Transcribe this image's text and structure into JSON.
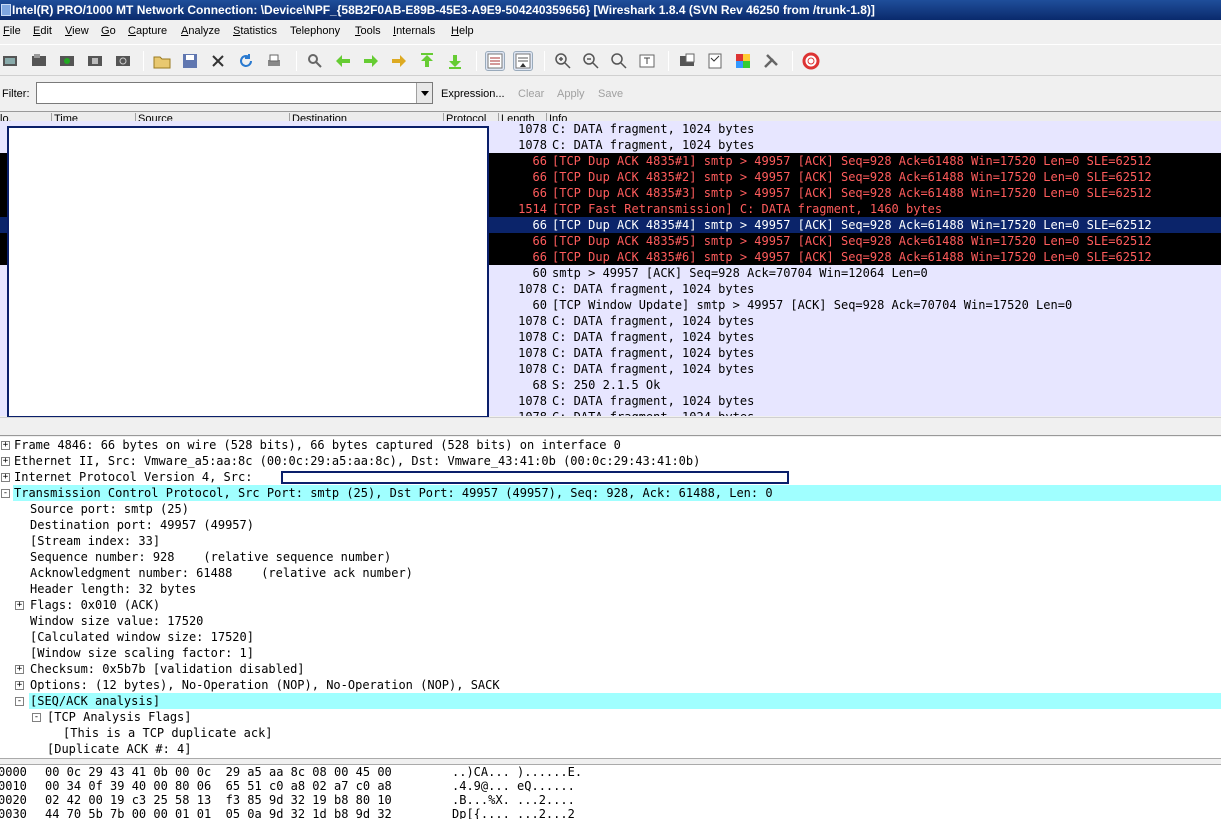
{
  "window": {
    "title": "Intel(R) PRO/1000 MT Network Connection: \\Device\\NPF_{58B2F0AB-E89B-45E3-A9E9-504240359656}  [Wireshark 1.8.4  (SVN Rev 46250 from /trunk-1.8)]"
  },
  "menu": [
    {
      "label": "File",
      "u": "F",
      "rest": "ile"
    },
    {
      "label": "Edit",
      "u": "E",
      "rest": "dit"
    },
    {
      "label": "View",
      "u": "V",
      "rest": "iew"
    },
    {
      "label": "Go",
      "u": "G",
      "rest": "o"
    },
    {
      "label": "Capture",
      "u": "C",
      "rest": "apture"
    },
    {
      "label": "Analyze",
      "u": "A",
      "rest": "nalyze"
    },
    {
      "label": "Statistics",
      "u": "S",
      "rest": "tatistics"
    },
    {
      "label": "Telephony",
      "u": "",
      "rest": "Telephony"
    },
    {
      "label": "Tools",
      "u": "T",
      "rest": "ools"
    },
    {
      "label": "Internals",
      "u": "I",
      "rest": "nternals"
    },
    {
      "label": "Help",
      "u": "H",
      "rest": "elp"
    }
  ],
  "toolbar": {
    "icons": [
      "interface-list-icon",
      "capture-options-icon",
      "start-capture-icon",
      "stop-capture-icon",
      "restart-capture-icon",
      "open-file-icon",
      "save-file-icon",
      "close-file-icon",
      "reload-icon",
      "print-icon",
      "find-icon",
      "go-back-icon",
      "go-forward-icon",
      "go-to-packet-icon",
      "first-packet-icon",
      "last-packet-icon",
      "colorize-icon",
      "auto-scroll-icon",
      "zoom-in-icon",
      "zoom-out-icon",
      "normal-size-icon",
      "resize-columns-icon",
      "capture-filters-icon",
      "display-filters-icon",
      "coloring-rules-icon",
      "preferences-icon",
      "help-icon"
    ]
  },
  "filter": {
    "label": "Filter:",
    "value": "",
    "expression": "Expression...",
    "clear": "Clear",
    "apply": "Apply",
    "save": "Save"
  },
  "columns": {
    "no": "lo.",
    "time": "Time",
    "source": "Source",
    "destination": "Destination",
    "protocol": "Protocol",
    "length": "Length",
    "info": "Info"
  },
  "packets": [
    {
      "style": "normal",
      "length": "1078",
      "info": "C: DATA fragment, 1024 bytes"
    },
    {
      "style": "normal",
      "length": "1078",
      "info": "C: DATA fragment, 1024 bytes"
    },
    {
      "style": "warn",
      "length": "66",
      "info": "[TCP Dup ACK 4835#1] smtp > 49957 [ACK] Seq=928 Ack=61488 Win=17520 Len=0 SLE=62512"
    },
    {
      "style": "warn",
      "length": "66",
      "info": "[TCP Dup ACK 4835#2] smtp > 49957 [ACK] Seq=928 Ack=61488 Win=17520 Len=0 SLE=62512"
    },
    {
      "style": "warn",
      "length": "66",
      "info": "[TCP Dup ACK 4835#3] smtp > 49957 [ACK] Seq=928 Ack=61488 Win=17520 Len=0 SLE=62512"
    },
    {
      "style": "warn",
      "length": "1514",
      "info": "[TCP Fast Retransmission] C: DATA fragment, 1460 bytes"
    },
    {
      "style": "sel",
      "length": "66",
      "info": "[TCP Dup ACK 4835#4] smtp > 49957 [ACK] Seq=928 Ack=61488 Win=17520 Len=0 SLE=62512"
    },
    {
      "style": "warn",
      "length": "66",
      "info": "[TCP Dup ACK 4835#5] smtp > 49957 [ACK] Seq=928 Ack=61488 Win=17520 Len=0 SLE=62512"
    },
    {
      "style": "warn",
      "length": "66",
      "info": "[TCP Dup ACK 4835#6] smtp > 49957 [ACK] Seq=928 Ack=61488 Win=17520 Len=0 SLE=62512"
    },
    {
      "style": "normal",
      "length": "60",
      "info": "smtp > 49957 [ACK] Seq=928 Ack=70704 Win=12064 Len=0"
    },
    {
      "style": "normal",
      "length": "1078",
      "info": "C: DATA fragment, 1024 bytes"
    },
    {
      "style": "normal",
      "length": "60",
      "info": "[TCP Window Update] smtp > 49957 [ACK] Seq=928 Ack=70704 Win=17520 Len=0"
    },
    {
      "style": "normal",
      "length": "1078",
      "info": "C: DATA fragment, 1024 bytes"
    },
    {
      "style": "normal",
      "length": "1078",
      "info": "C: DATA fragment, 1024 bytes"
    },
    {
      "style": "normal",
      "length": "1078",
      "info": "C: DATA fragment, 1024 bytes"
    },
    {
      "style": "normal",
      "length": "1078",
      "info": "C: DATA fragment, 1024 bytes"
    },
    {
      "style": "normal",
      "length": "68",
      "info": "S: 250 2.1.5 Ok"
    },
    {
      "style": "normal",
      "length": "1078",
      "info": "C: DATA fragment, 1024 bytes"
    },
    {
      "style": "normal",
      "length": "1078",
      "info": "C: DATA fragment, 1024 bytes"
    }
  ],
  "details": [
    {
      "indent": 0,
      "exp": "+",
      "hl": false,
      "text": "Frame 4846: 66 bytes on wire (528 bits), 66 bytes captured (528 bits) on interface 0"
    },
    {
      "indent": 0,
      "exp": "+",
      "hl": false,
      "text": "Ethernet II, Src: Vmware_a5:aa:8c (00:0c:29:a5:aa:8c), Dst: Vmware_43:41:0b (00:0c:29:43:41:0b)"
    },
    {
      "indent": 0,
      "exp": "+",
      "hl": false,
      "text": "Internet Protocol Version 4, Src:"
    },
    {
      "indent": 0,
      "exp": "-",
      "hl": true,
      "text": "Transmission Control Protocol, Src Port: smtp (25), Dst Port: 49957 (49957), Seq: 928, Ack: 61488, Len: 0"
    },
    {
      "indent": 1,
      "exp": "",
      "hl": false,
      "text": "Source port: smtp (25)"
    },
    {
      "indent": 1,
      "exp": "",
      "hl": false,
      "text": "Destination port: 49957 (49957)"
    },
    {
      "indent": 1,
      "exp": "",
      "hl": false,
      "text": "[Stream index: 33]"
    },
    {
      "indent": 1,
      "exp": "",
      "hl": false,
      "text": "Sequence number: 928    (relative sequence number)"
    },
    {
      "indent": 1,
      "exp": "",
      "hl": false,
      "text": "Acknowledgment number: 61488    (relative ack number)"
    },
    {
      "indent": 1,
      "exp": "",
      "hl": false,
      "text": "Header length: 32 bytes"
    },
    {
      "indent": 1,
      "exp": "+",
      "hl": false,
      "text": "Flags: 0x010 (ACK)"
    },
    {
      "indent": 1,
      "exp": "",
      "hl": false,
      "text": "Window size value: 17520"
    },
    {
      "indent": 1,
      "exp": "",
      "hl": false,
      "text": "[Calculated window size: 17520]"
    },
    {
      "indent": 1,
      "exp": "",
      "hl": false,
      "text": "[Window size scaling factor: 1]"
    },
    {
      "indent": 1,
      "exp": "+",
      "hl": false,
      "text": "Checksum: 0x5b7b [validation disabled]"
    },
    {
      "indent": 1,
      "exp": "+",
      "hl": false,
      "text": "Options: (12 bytes), No-Operation (NOP), No-Operation (NOP), SACK"
    },
    {
      "indent": 1,
      "exp": "-",
      "hl": true,
      "text": "[SEQ/ACK analysis]"
    },
    {
      "indent": 2,
      "exp": "-",
      "hl": false,
      "text": "[TCP Analysis Flags]"
    },
    {
      "indent": 3,
      "exp": "",
      "hl": false,
      "text": "[This is a TCP duplicate ack]"
    },
    {
      "indent": 2,
      "exp": "",
      "hl": false,
      "text": "[Duplicate ACK #: 4]"
    }
  ],
  "hex": [
    {
      "offset": "0000",
      "bytes": "00 0c 29 43 41 0b 00 0c  29 a5 aa 8c 08 00 45 00",
      "ascii": "..)CA... )......E."
    },
    {
      "offset": "0010",
      "bytes": "00 34 0f 39 40 00 80 06  65 51 c0 a8 02 a7 c0 a8",
      "ascii": ".4.9@... eQ......"
    },
    {
      "offset": "0020",
      "bytes": "02 42 00 19 c3 25 58 13  f3 85 9d 32 19 b8 80 10",
      "ascii": ".B...%X. ...2...."
    },
    {
      "offset": "0030",
      "bytes": "44 70 5b 7b 00 00 01 01  05 0a 9d 32 1d b8 9d 32",
      "ascii": "Dp[{.... ...2...2"
    }
  ]
}
